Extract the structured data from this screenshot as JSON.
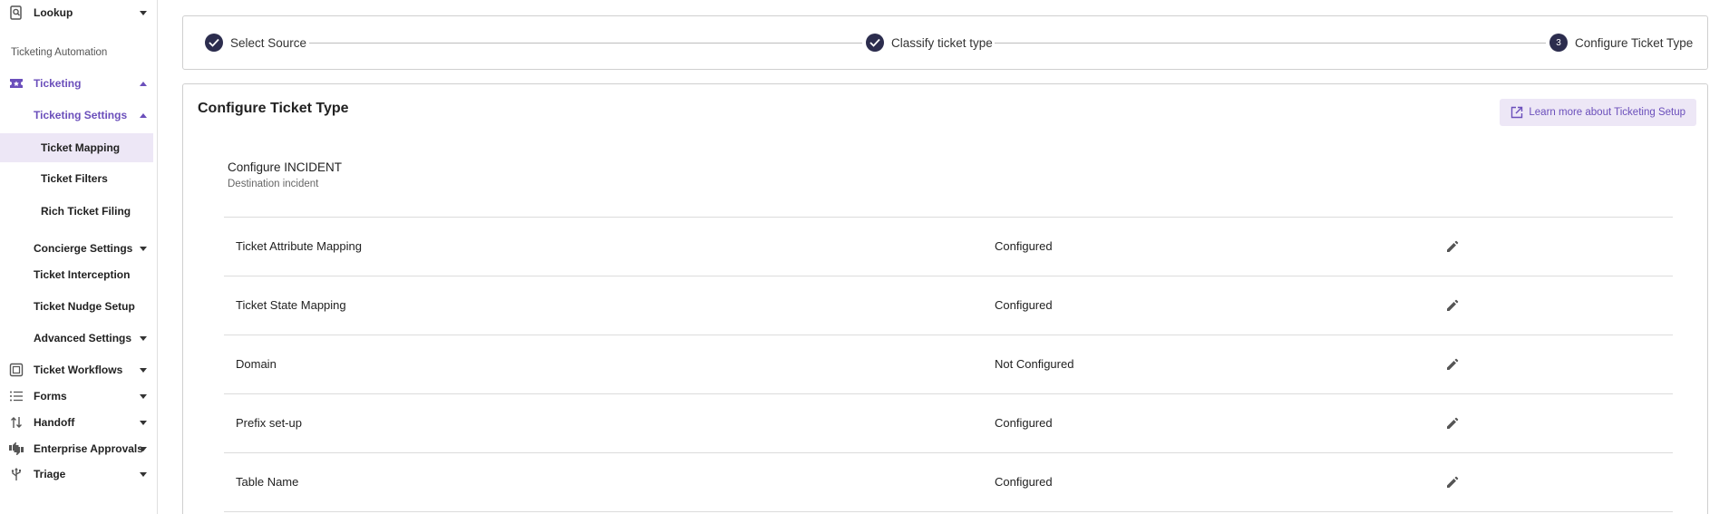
{
  "sidebar": {
    "lookup": "Lookup",
    "section_label": "Ticketing Automation",
    "ticketing": "Ticketing",
    "ticketing_settings": "Ticketing Settings",
    "ticket_mapping": "Ticket Mapping",
    "ticket_filters": "Ticket Filters",
    "rich_ticket_filing": "Rich Ticket Filing",
    "concierge_settings": "Concierge Settings",
    "ticket_interception": "Ticket Interception",
    "ticket_nudge_setup": "Ticket Nudge Setup",
    "advanced_settings": "Advanced Settings",
    "ticket_workflows": "Ticket Workflows",
    "forms": "Forms",
    "handoff": "Handoff",
    "enterprise_approvals": "Enterprise Approvals",
    "triage": "Triage"
  },
  "stepper": {
    "steps": [
      {
        "label": "Select Source",
        "state": "done"
      },
      {
        "label": "Classify ticket type",
        "state": "done"
      },
      {
        "label": "Configure Ticket Type",
        "state": "active",
        "number": "3"
      }
    ]
  },
  "card": {
    "title": "Configure Ticket Type",
    "learn_more": "Learn more about Ticketing Setup",
    "config_title": "Configure INCIDENT",
    "config_subtitle": "Destination incident",
    "rows": [
      {
        "name": "Ticket Attribute Mapping",
        "status": "Configured"
      },
      {
        "name": "Ticket State Mapping",
        "status": "Configured"
      },
      {
        "name": "Domain",
        "status": "Not Configured"
      },
      {
        "name": "Prefix set-up",
        "status": "Configured"
      },
      {
        "name": "Table Name",
        "status": "Configured"
      }
    ]
  },
  "colors": {
    "accent": "#6b4fbb",
    "accent_bg": "#ede7f6",
    "step_circle": "#2c2d4e"
  }
}
